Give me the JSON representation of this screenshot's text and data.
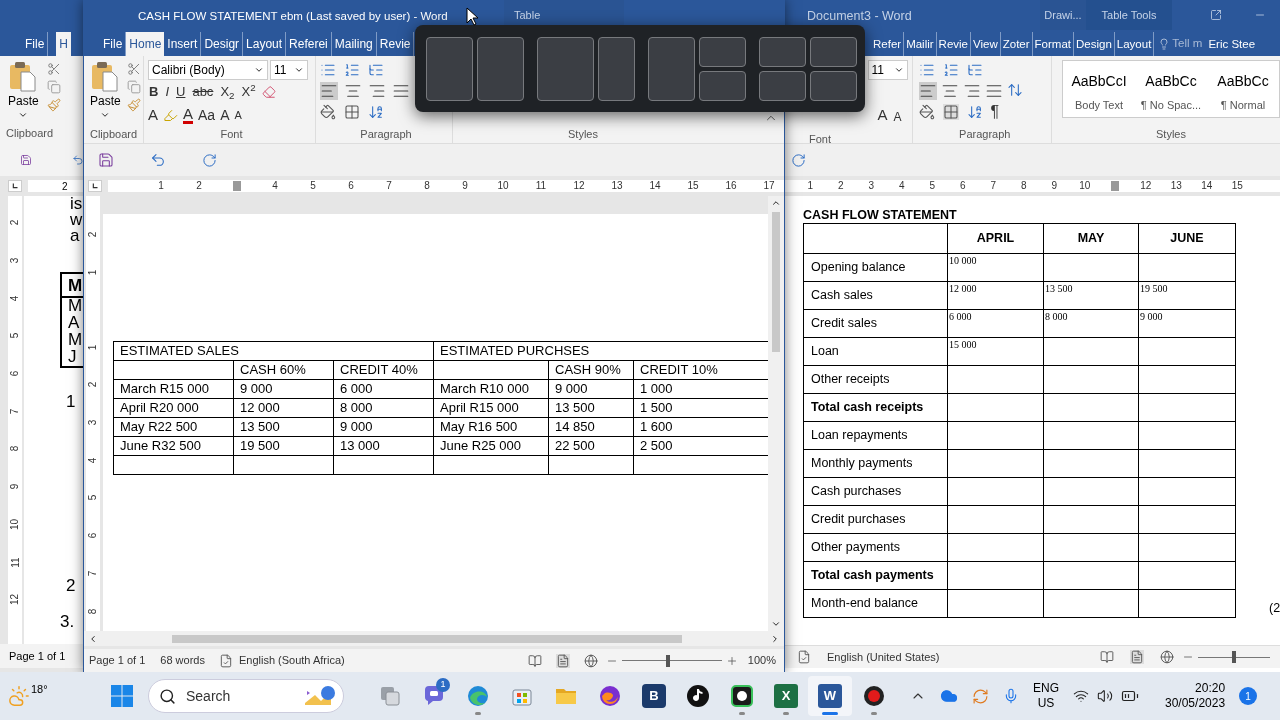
{
  "back_window": {
    "tabs": [
      {
        "label": "File",
        "selected": false
      },
      {
        "label": "H",
        "selected": true
      }
    ],
    "paste_label": "Paste",
    "clipboard_label": "Clipboard",
    "ruler_labels": [
      "2"
    ],
    "vruler_labels": [
      "2",
      "3",
      "4",
      "5",
      "6",
      "7",
      "8",
      "9",
      "10",
      "11",
      "12"
    ],
    "text_lines": [
      "is",
      "w",
      "a"
    ],
    "table_rows": [
      "M",
      "M",
      "A",
      "M",
      "J"
    ],
    "list_numbers": [
      "1",
      "2",
      "3."
    ],
    "status": "Page 1 of 1"
  },
  "front_window": {
    "title": "CASH FLOW STATEMENT ebm (Last saved by user) - Word",
    "context_tab": "Table",
    "tabs": [
      {
        "label": "File",
        "selected": false
      },
      {
        "label": "Home",
        "selected": true
      },
      {
        "label": "Insert",
        "selected": false
      },
      {
        "label": "Desigr",
        "selected": false
      },
      {
        "label": "Layout",
        "selected": false
      },
      {
        "label": "Referei",
        "selected": false
      },
      {
        "label": "Mailing",
        "selected": false
      },
      {
        "label": "Revie",
        "selected": false
      }
    ],
    "paste_label": "Paste",
    "font_name": "Calibri (Body)",
    "font_size": "11",
    "format_buttons": [
      {
        "kind": "bold",
        "text": "B"
      },
      {
        "kind": "italic",
        "text": "I"
      },
      {
        "kind": "underline",
        "text": "U"
      },
      {
        "kind": "strike",
        "text": "abc"
      },
      {
        "kind": "plain",
        "text": "X$_{2}$"
      },
      {
        "kind": "plain",
        "text": "X$^{2}$"
      }
    ],
    "effect_buttons": [
      {
        "kind": "effects",
        "text": "A"
      },
      {
        "kind": "highlight"
      },
      {
        "kind": "color",
        "text": "A"
      },
      {
        "kind": "plain",
        "text": "Aa"
      },
      {
        "kind": "plain",
        "text": "A"
      },
      {
        "kind": "small",
        "text": "A"
      }
    ],
    "groups": [
      "Clipboard",
      "Font",
      "Paragraph",
      "Styles"
    ],
    "ruler_labels": [
      "1",
      "2",
      "4",
      "5",
      "6",
      "7",
      "8",
      "9",
      "10",
      "11",
      "12",
      "13",
      "14",
      "15",
      "16",
      "17"
    ],
    "vruler_labels": [
      "2",
      "1",
      "1",
      "2",
      "3",
      "4",
      "5",
      "6",
      "7",
      "8"
    ],
    "sales": {
      "title": "ESTIMATED SALES",
      "columns": [
        "CASH 60%",
        "CREDIT 40%"
      ],
      "rows": [
        {
          "month": "March R15 000",
          "cash": "9 000",
          "credit": "6 000"
        },
        {
          "month": "April R20 000",
          "cash": "12 000",
          "credit": "8 000"
        },
        {
          "month": "May R22 500",
          "cash": "13 500",
          "credit": "9 000"
        },
        {
          "month": "June R32 500",
          "cash": "19 500",
          "credit": "13 000"
        }
      ]
    },
    "purchases": {
      "title": "ESTIMATED PURCHSES",
      "columns": [
        "CASH 90%",
        "CREDIT 10%"
      ],
      "rows": [
        {
          "month": "March R10 000",
          "cash": "9 000",
          "credit": "1 000"
        },
        {
          "month": "April R15 000",
          "cash": "13 500",
          "credit": "1 500"
        },
        {
          "month": "May R16 500",
          "cash": "14 850",
          "credit": "1 600"
        },
        {
          "month": "June R25 000",
          "cash": "22 500",
          "credit": "2 500"
        }
      ]
    },
    "status": {
      "page": "Page 1 of 1",
      "words": "68 words",
      "language": "English (South Africa)",
      "zoom": "100%",
      "zoom_slider": {
        "level": 0.46
      }
    }
  },
  "right_window": {
    "title": "Document3 - Word",
    "context_tabs": [
      "Drawi...",
      "Table Tools"
    ],
    "tabs": [
      {
        "label": "Refer",
        "selected": false
      },
      {
        "label": "Mailir",
        "selected": false
      },
      {
        "label": "Revie",
        "selected": false
      },
      {
        "label": "View",
        "selected": false
      },
      {
        "label": "Zoter",
        "selected": false
      },
      {
        "label": "Format",
        "selected": false
      },
      {
        "label": "Design",
        "selected": false
      },
      {
        "label": "Layout",
        "selected": false
      }
    ],
    "tell_me": "Tell m",
    "user": "Eric Stee",
    "font_size": "11",
    "grow_shrink": [
      "A",
      "A"
    ],
    "show_marks": "¶",
    "styles": [
      {
        "sample": "AaBbCcI",
        "name": "Body Text"
      },
      {
        "sample": "AaBbCc",
        "name": "¶ No Spac..."
      },
      {
        "sample": "AaBbCc",
        "name": "¶ Normal"
      }
    ],
    "groups": [
      "Font",
      "Paragraph",
      "Styles"
    ],
    "ruler_labels": [
      "1",
      "2",
      "3",
      "4",
      "5",
      "6",
      "7",
      "8",
      "9",
      "10",
      "12",
      "13",
      "14",
      "15"
    ],
    "heading": "CASH FLOW STATEMENT",
    "columns": [
      "APRIL",
      "MAY",
      "JUNE"
    ],
    "rows": [
      {
        "label": "Opening balance",
        "bold": false,
        "values": [
          "10 000"
        ]
      },
      {
        "label": "Cash sales",
        "bold": false,
        "values": [
          "12 000",
          "13 500",
          "19 500"
        ]
      },
      {
        "label": "Credit sales",
        "bold": false,
        "values": [
          "6 000",
          "8 000",
          "9 000"
        ]
      },
      {
        "label": "Loan",
        "bold": false,
        "values": [
          "15 000"
        ]
      },
      {
        "label": "Other receipts",
        "bold": false,
        "values": []
      },
      {
        "label": "Total cash receipts",
        "bold": true,
        "values": []
      },
      {
        "label": "Loan repayments",
        "bold": false,
        "values": []
      },
      {
        "label": "Monthly payments",
        "bold": false,
        "values": []
      },
      {
        "label": "Cash purchases",
        "bold": false,
        "values": []
      },
      {
        "label": "Credit purchases",
        "bold": false,
        "values": []
      },
      {
        "label": "Other payments",
        "bold": false,
        "values": []
      },
      {
        "label": "Total cash payments",
        "bold": true,
        "values": []
      },
      {
        "label": "Month-end balance",
        "bold": false,
        "values": []
      }
    ],
    "margin_mark": "(2",
    "status_language": "English (United States)",
    "zoom_slider": {
      "level": 0.5
    }
  },
  "taskbar": {
    "temperature": "18°",
    "search_placeholder": "Search",
    "apps": [
      {
        "kind": "taskview",
        "open": false
      },
      {
        "kind": "chat",
        "open": false,
        "badge": "1"
      },
      {
        "kind": "wave",
        "open": true
      },
      {
        "kind": "store",
        "open": false
      },
      {
        "kind": "folder",
        "open": false
      },
      {
        "kind": "fox",
        "open": false
      },
      {
        "kind": "letter",
        "open": false,
        "label": "B"
      },
      {
        "kind": "note",
        "open": false
      },
      {
        "kind": "game",
        "open": true
      },
      {
        "kind": "sheet",
        "open": true,
        "label": "X"
      },
      {
        "kind": "doc",
        "open": true,
        "selected": true,
        "label": "W"
      },
      {
        "kind": "record",
        "open": true
      }
    ],
    "language": "ENG",
    "region": "US",
    "time": "20:20",
    "date": "30/05/2023",
    "notifications": "1"
  }
}
